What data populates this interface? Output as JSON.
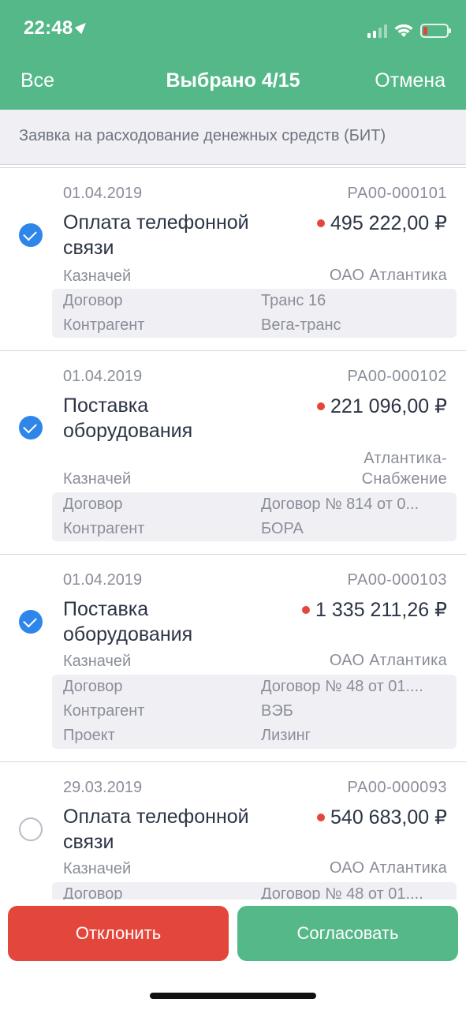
{
  "status": {
    "time": "22:48"
  },
  "nav": {
    "left": "Все",
    "title": "Выбрано 4/15",
    "right": "Отмена"
  },
  "subheader": "Заявка на расходование денежных средств (БИТ)",
  "items": [
    {
      "checked": true,
      "date": "01.04.2019",
      "number": "РА00-000101",
      "title": "Оплата телефонной связи",
      "amount": "495 222,00 ₽",
      "treasurer_label": "Казначей",
      "treasurer": "ОАО Атлантика",
      "details": [
        {
          "label": "Договор",
          "value": "Транс 16"
        },
        {
          "label": "Контрагент",
          "value": "Вега-транс"
        }
      ]
    },
    {
      "checked": true,
      "date": "01.04.2019",
      "number": "РА00-000102",
      "title": "Поставка оборудования",
      "amount": "221 096,00 ₽",
      "treasurer_label": "Казначей",
      "treasurer": "Атлантика-Снабжение",
      "details": [
        {
          "label": "Договор",
          "value": "Договор № 814 от 0..."
        },
        {
          "label": "Контрагент",
          "value": "БОРА"
        }
      ]
    },
    {
      "checked": true,
      "date": "01.04.2019",
      "number": "РА00-000103",
      "title": "Поставка оборудования",
      "amount": "1 335 211,26 ₽",
      "treasurer_label": "Казначей",
      "treasurer": "ОАО Атлантика",
      "details": [
        {
          "label": "Договор",
          "value": "Договор № 48 от 01...."
        },
        {
          "label": "Контрагент",
          "value": "ВЭБ"
        },
        {
          "label": "Проект",
          "value": "Лизинг"
        }
      ]
    },
    {
      "checked": false,
      "date": "29.03.2019",
      "number": "РА00-000093",
      "title": "Оплата телефонной связи",
      "amount": "540 683,00 ₽",
      "treasurer_label": "Казначей",
      "treasurer": "ОАО Атлантика",
      "details": [
        {
          "label": "Договор",
          "value": "Договор № 48 от 01...."
        }
      ]
    }
  ],
  "actions": {
    "reject": "Отклонить",
    "approve": "Согласовать"
  },
  "colors": {
    "header": "#55b889",
    "reject": "#e3473b",
    "approve": "#55b889",
    "checkbox": "#2f86ea",
    "amount_dot": "#e3473b"
  }
}
